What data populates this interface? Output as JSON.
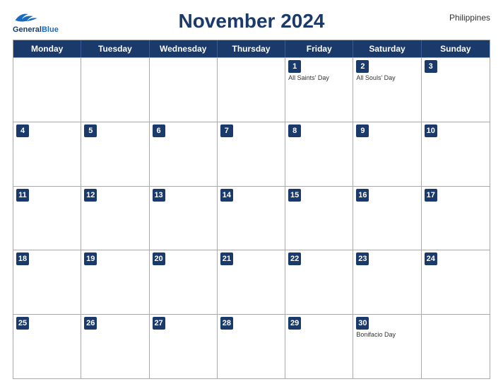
{
  "header": {
    "logo": {
      "line1": "General",
      "line2": "Blue"
    },
    "title": "November 2024",
    "country": "Philippines"
  },
  "dayHeaders": [
    "Monday",
    "Tuesday",
    "Wednesday",
    "Thursday",
    "Friday",
    "Saturday",
    "Sunday"
  ],
  "weeks": [
    [
      {
        "day": "",
        "events": []
      },
      {
        "day": "",
        "events": []
      },
      {
        "day": "",
        "events": []
      },
      {
        "day": "",
        "events": []
      },
      {
        "day": "1",
        "events": [
          "All Saints' Day"
        ]
      },
      {
        "day": "2",
        "events": [
          "All Souls' Day"
        ]
      },
      {
        "day": "3",
        "events": []
      }
    ],
    [
      {
        "day": "4",
        "events": []
      },
      {
        "day": "5",
        "events": []
      },
      {
        "day": "6",
        "events": []
      },
      {
        "day": "7",
        "events": []
      },
      {
        "day": "8",
        "events": []
      },
      {
        "day": "9",
        "events": []
      },
      {
        "day": "10",
        "events": []
      }
    ],
    [
      {
        "day": "11",
        "events": []
      },
      {
        "day": "12",
        "events": []
      },
      {
        "day": "13",
        "events": []
      },
      {
        "day": "14",
        "events": []
      },
      {
        "day": "15",
        "events": []
      },
      {
        "day": "16",
        "events": []
      },
      {
        "day": "17",
        "events": []
      }
    ],
    [
      {
        "day": "18",
        "events": []
      },
      {
        "day": "19",
        "events": []
      },
      {
        "day": "20",
        "events": []
      },
      {
        "day": "21",
        "events": []
      },
      {
        "day": "22",
        "events": []
      },
      {
        "day": "23",
        "events": []
      },
      {
        "day": "24",
        "events": []
      }
    ],
    [
      {
        "day": "25",
        "events": []
      },
      {
        "day": "26",
        "events": []
      },
      {
        "day": "27",
        "events": []
      },
      {
        "day": "28",
        "events": []
      },
      {
        "day": "29",
        "events": []
      },
      {
        "day": "30",
        "events": [
          "Bonifacio Day"
        ]
      },
      {
        "day": "",
        "events": []
      }
    ]
  ]
}
